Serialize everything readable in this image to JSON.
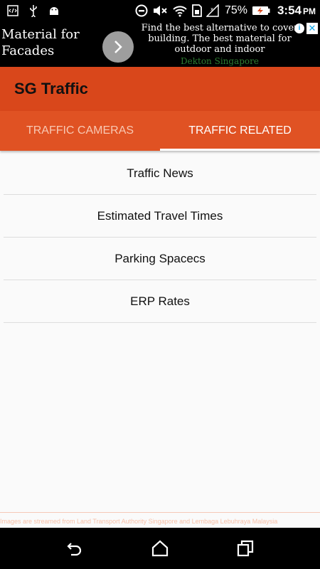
{
  "status_bar": {
    "battery_percent": "75%",
    "time": "3:54",
    "ampm": "PM"
  },
  "ad": {
    "left_text": "Material for Facades",
    "right_text": "Find the best alternative to cover building. The best material for outdoor and indoor",
    "brand": "Dekton Singapore",
    "info_label": "i",
    "close_label": "✕"
  },
  "toolbar": {
    "title": "SG Traffic"
  },
  "tabs": [
    {
      "label": "TRAFFIC CAMERAS"
    },
    {
      "label": "TRAFFIC RELATED"
    }
  ],
  "menu_items": [
    {
      "label": "Traffic News"
    },
    {
      "label": "Estimated Travel Times"
    },
    {
      "label": "Parking Spacecs"
    },
    {
      "label": "ERP Rates"
    }
  ],
  "footer_note": "Images are streamed from Land Transport Authority Singapore and Lembaga Lebuhraya Malaysia",
  "colors": {
    "primary": "#d9471b",
    "tab_bar": "#e05223",
    "status_bar": "#000000"
  }
}
